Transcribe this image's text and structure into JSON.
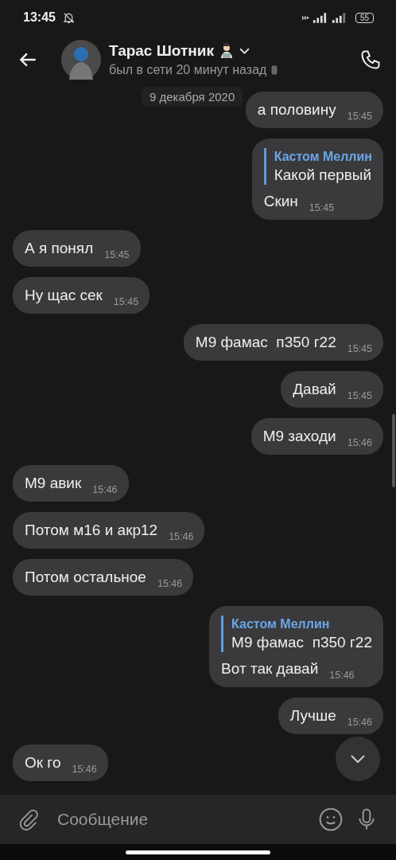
{
  "status_bar": {
    "time": "13:45",
    "network": "H+",
    "battery": "55"
  },
  "header": {
    "name": "Тарас Шотник",
    "status": "был в сети 20 минут назад"
  },
  "date_chip": "9 декабря 2020",
  "messages": [
    {
      "outgoing": true,
      "text": "а половину",
      "time": "15:45"
    },
    {
      "outgoing": true,
      "reply": {
        "author": "Кастом Меллин",
        "text": "Какой первый"
      },
      "text": "Скин",
      "time": "15:45"
    },
    {
      "outgoing": false,
      "text": "А я понял",
      "time": "15:45"
    },
    {
      "outgoing": false,
      "text": "Ну щас сек",
      "time": "15:45"
    },
    {
      "outgoing": true,
      "text": "М9 фамас  п350 г22",
      "time": "15:45"
    },
    {
      "outgoing": true,
      "text": "Давай",
      "time": "15:45"
    },
    {
      "outgoing": true,
      "text": "М9 заходи",
      "time": "15:46"
    },
    {
      "outgoing": false,
      "text": "М9 авик",
      "time": "15:46"
    },
    {
      "outgoing": false,
      "text": "Потом м16 и акр12",
      "time": "15:46"
    },
    {
      "outgoing": false,
      "text": "Потом остальное",
      "time": "15:46"
    },
    {
      "outgoing": true,
      "reply": {
        "author": "Кастом Меллин",
        "text": "М9 фамас  п350 г22"
      },
      "text": "Вот так давай",
      "time": "15:46"
    },
    {
      "outgoing": true,
      "text": "Лучше",
      "time": "15:46"
    },
    {
      "outgoing": false,
      "text": "Ок го",
      "time": "15:46"
    }
  ],
  "composer": {
    "placeholder": "Сообщение"
  }
}
